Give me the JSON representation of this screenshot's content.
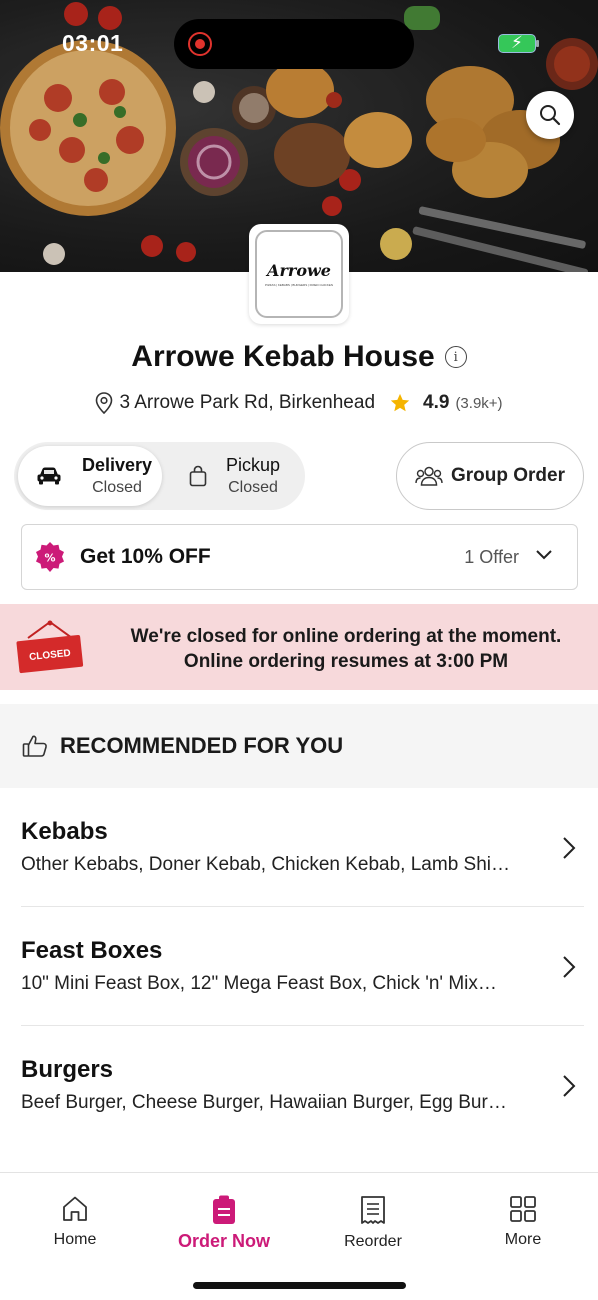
{
  "status_bar": {
    "time": "03:01"
  },
  "restaurant": {
    "logo_text": "Arrowe",
    "logo_subtext": "PIZZAS | KEBABS | BURGERS | FRIED CHICKEN",
    "name": "Arrowe Kebab House",
    "address": "3 Arrowe Park Rd, Birkenhead",
    "rating": "4.9",
    "rating_count": "(3.9k+)"
  },
  "modes": {
    "delivery": {
      "label": "Delivery",
      "status": "Closed"
    },
    "pickup": {
      "label": "Pickup",
      "status": "Closed"
    },
    "selected": "delivery"
  },
  "group_order": {
    "label": "Group Order"
  },
  "offer": {
    "title": "Get 10% OFF",
    "count": "1 Offer"
  },
  "closed_notice": {
    "sign_text": "CLOSED",
    "line1": "We're closed for online ordering at the moment.",
    "line2": "Online ordering resumes at 3:00 PM"
  },
  "recommended": {
    "title": "RECOMMENDED FOR YOU"
  },
  "categories": [
    {
      "name": "Kebabs",
      "items": "Other Kebabs, Doner Kebab, Chicken Kebab, Lamb Shi…"
    },
    {
      "name": "Feast Boxes",
      "items": "10\" Mini Feast Box, 12\" Mega Feast Box, Chick 'n' Mix…"
    },
    {
      "name": "Burgers",
      "items": "Beef Burger, Cheese Burger, Hawaiian Burger, Egg Bur…"
    }
  ],
  "nav": {
    "items": [
      {
        "label": "Home",
        "icon": "home-icon"
      },
      {
        "label": "Order Now",
        "icon": "order-icon"
      },
      {
        "label": "Reorder",
        "icon": "receipt-icon"
      },
      {
        "label": "More",
        "icon": "grid-icon"
      }
    ],
    "active": "Order Now"
  },
  "colors": {
    "accent": "#cc1a78",
    "closed_banner_bg": "#f7d9db",
    "closed_sign": "#d42a2a",
    "star": "#f5b400"
  }
}
